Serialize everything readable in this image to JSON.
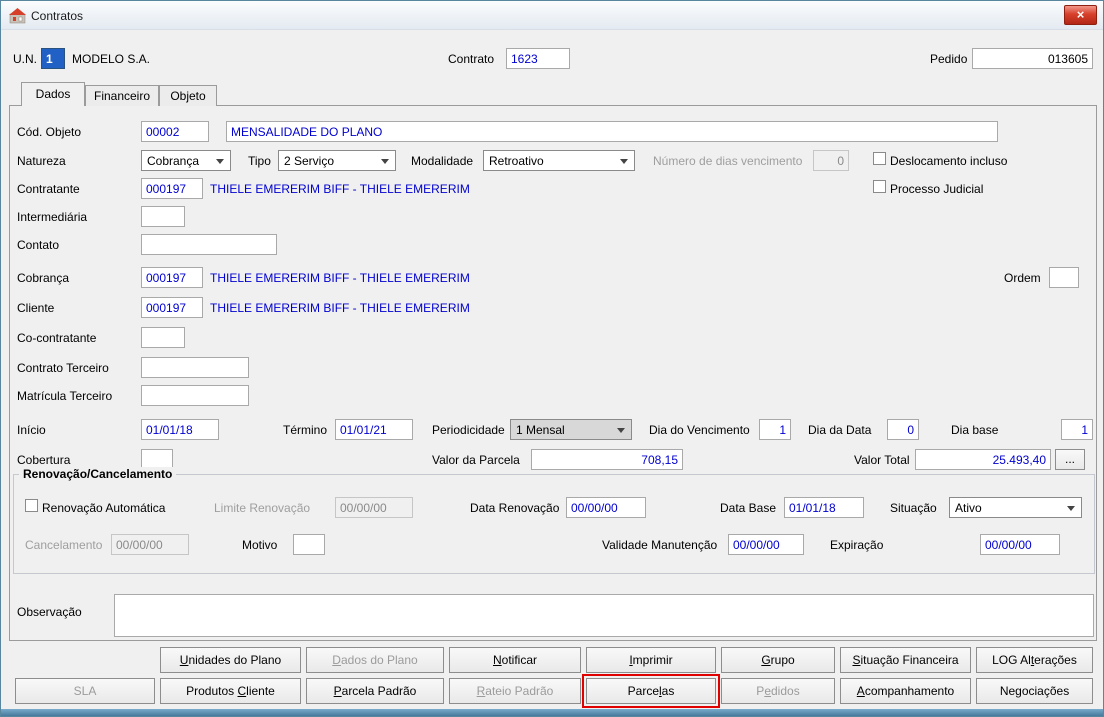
{
  "window": {
    "title": "Contratos",
    "close_glyph": "×"
  },
  "header": {
    "un": {
      "label": "U.N.",
      "value": "1",
      "company": "MODELO S.A."
    },
    "contrato": {
      "label": "Contrato",
      "value": "1623"
    },
    "pedido": {
      "label": "Pedido",
      "value": "013605"
    }
  },
  "tabs": {
    "dados": "Dados",
    "financeiro": "Financeiro",
    "objeto": "Objeto"
  },
  "form": {
    "cod_objeto": {
      "label": "Cód. Objeto",
      "code": "00002",
      "description": "MENSALIDADE DO PLANO"
    },
    "natureza": {
      "label": "Natureza",
      "value": "Cobrança"
    },
    "tipo": {
      "label": "Tipo",
      "value": "2 Serviço"
    },
    "modalidade": {
      "label": "Modalidade",
      "value": "Retroativo"
    },
    "dias_vencimento": {
      "label": "Número de dias vencimento",
      "value": "0"
    },
    "deslocamento_incluso": {
      "label": "Deslocamento incluso",
      "checked": false
    },
    "contratante": {
      "label": "Contratante",
      "code": "000197",
      "name": "THIELE EMERERIM BIFF - THIELE EMERERIM"
    },
    "processo_judicial": {
      "label": "Processo Judicial",
      "checked": false
    },
    "intermediaria": {
      "label": "Intermediária",
      "value": ""
    },
    "contato": {
      "label": "Contato",
      "value": ""
    },
    "cobranca": {
      "label": "Cobrança",
      "code": "000197",
      "name": "THIELE EMERERIM BIFF - THIELE EMERERIM"
    },
    "ordem": {
      "label": "Ordem",
      "value": ""
    },
    "cliente": {
      "label": "Cliente",
      "code": "000197",
      "name": "THIELE EMERERIM BIFF - THIELE EMERERIM"
    },
    "co_contratante": {
      "label": "Co-contratante",
      "value": ""
    },
    "contrato_terceiro": {
      "label": "Contrato Terceiro",
      "value": ""
    },
    "matricula_terceiro": {
      "label": "Matrícula Terceiro",
      "value": ""
    },
    "inicio": {
      "label": "Início",
      "value": "01/01/18"
    },
    "termino": {
      "label": "Término",
      "value": "01/01/21"
    },
    "periodicidade": {
      "label": "Periodicidade",
      "value": "1 Mensal"
    },
    "dia_vencimento": {
      "label": "Dia do Vencimento",
      "value": "1"
    },
    "dia_data": {
      "label": "Dia da Data",
      "value": "0"
    },
    "dia_base": {
      "label": "Dia base",
      "value": "1"
    },
    "cobertura": {
      "label": "Cobertura",
      "value": ""
    },
    "valor_parcela": {
      "label": "Valor da Parcela",
      "value": "708,15"
    },
    "valor_total": {
      "label": "Valor Total",
      "value": "25.493,40",
      "more_label": "..."
    },
    "observacao": {
      "label": "Observação",
      "value": ""
    }
  },
  "renovacao": {
    "title": "Renovação/Cancelamento",
    "renovacao_automatica": {
      "label": "Renovação Automática",
      "checked": false
    },
    "limite_renovacao": {
      "label": "Limite Renovação",
      "value": "00/00/00"
    },
    "data_renovacao": {
      "label": "Data Renovação",
      "value": "00/00/00"
    },
    "data_base": {
      "label": "Data Base",
      "value": "01/01/18"
    },
    "situacao": {
      "label": "Situação",
      "value": "Ativo"
    },
    "cancelamento": {
      "label": "Cancelamento",
      "value": "00/00/00"
    },
    "motivo": {
      "label": "Motivo",
      "value": ""
    },
    "validade_manutencao": {
      "label": "Validade Manutenção",
      "value": "00/00/00"
    },
    "expiracao": {
      "label": "Expiração",
      "value": "00/00/00"
    }
  },
  "buttons": {
    "unidades_plano": "&Unidades do Plano",
    "dados_plano": "&Dados do Plano",
    "notificar": "&Notificar",
    "imprimir": "&Imprimir",
    "grupo": "&Grupo",
    "situacao_financeira": "&Situação Financeira",
    "log_alteracoes": "LOG Al&terações",
    "sla": "SLA",
    "produtos_cliente": "Produtos &Cliente",
    "parcela_padrao": "&Parcela Padrão",
    "rateio_padrao": "&Rateio Padrão",
    "parcelas": "Parce&las",
    "pedidos": "P&edidos",
    "acompanhamento": "&Acompanhamento",
    "negociacoes": "Negociações"
  }
}
